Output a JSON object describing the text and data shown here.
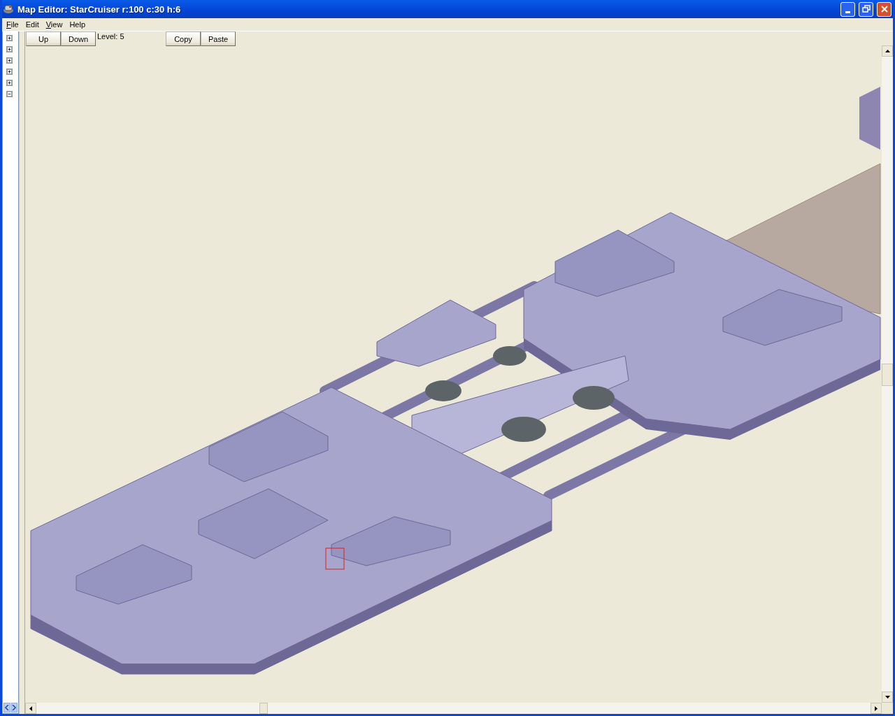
{
  "window": {
    "title": "Map Editor: StarCruiser r:100 c:30 h:6"
  },
  "menu": [
    {
      "label": "File",
      "mnemonic": true
    },
    {
      "label": "Edit",
      "mnemonic": false
    },
    {
      "label": "View",
      "mnemonic": true
    },
    {
      "label": "Help",
      "mnemonic": false
    }
  ],
  "tree": {
    "nodes": [
      {
        "expanded": false
      },
      {
        "expanded": false
      },
      {
        "expanded": false
      },
      {
        "expanded": false
      },
      {
        "expanded": false
      },
      {
        "expanded": true
      }
    ]
  },
  "toolbar": {
    "level_buttons": [
      "Up",
      "Down"
    ],
    "level_label": "Level: 5",
    "clipboard_buttons": [
      "Copy",
      "Paste"
    ]
  }
}
